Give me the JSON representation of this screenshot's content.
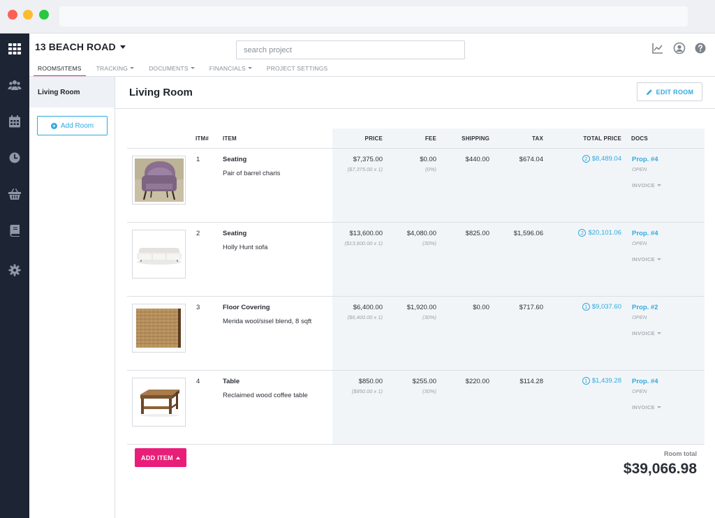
{
  "header": {
    "project_title": "13 BEACH ROAD",
    "search_placeholder": "search project",
    "tabs": [
      {
        "label": "ROOMS/ITEMS",
        "active": true,
        "dropdown": false
      },
      {
        "label": "TRACKING",
        "active": false,
        "dropdown": true
      },
      {
        "label": "DOCUMENTS",
        "active": false,
        "dropdown": true
      },
      {
        "label": "FINANCIALS",
        "active": false,
        "dropdown": true
      },
      {
        "label": "PROJECT SETTINGS",
        "active": false,
        "dropdown": false
      }
    ],
    "icons": [
      "chart-icon",
      "user-icon",
      "help-icon"
    ]
  },
  "rail": {
    "icons": [
      "apps-grid-icon",
      "people-icon",
      "calendar-icon",
      "clock-icon",
      "basket-icon",
      "book-icon",
      "gear-icon"
    ]
  },
  "sidebar": {
    "rooms": [
      {
        "label": "Living Room"
      }
    ],
    "add_room_label": "Add Room"
  },
  "main": {
    "room_title": "Living Room",
    "edit_room_label": "EDIT ROOM",
    "columns": {
      "itm": "ITM#",
      "item": "ITEM",
      "price": "PRICE",
      "fee": "FEE",
      "shipping": "SHIPPING",
      "tax": "TAX",
      "total_price": "TOTAL PRICE",
      "docs": "DOCS"
    },
    "rows": [
      {
        "num": "1",
        "category": "Seating",
        "description": "Pair of barrel charis",
        "image": "barrel-chair-image",
        "price": "$7,375.00",
        "price_detail": "($7,375.00 x 1)",
        "fee": "$0.00",
        "fee_detail": "(0%)",
        "shipping": "$440.00",
        "tax": "$674.04",
        "doc_count": "2",
        "total_price": "$8,489.04",
        "doc": "Prop. #4",
        "doc_status": "OPEN",
        "invoice_label": "INVOICE"
      },
      {
        "num": "2",
        "category": "Seating",
        "description": "Holly Hunt sofa",
        "image": "sofa-image",
        "price": "$13,600.00",
        "price_detail": "($13,600.00 x 1)",
        "fee": "$4,080.00",
        "fee_detail": "(30%)",
        "shipping": "$825.00",
        "tax": "$1,596.06",
        "doc_count": "2",
        "total_price": "$20,101.06",
        "doc": "Prop. #4",
        "doc_status": "OPEN",
        "invoice_label": "INVOICE"
      },
      {
        "num": "3",
        "category": "Floor Covering",
        "description": "Merida wool/sisel blend, 8 sqft",
        "image": "rug-image",
        "price": "$6,400.00",
        "price_detail": "($6,400.00 x 1)",
        "fee": "$1,920.00",
        "fee_detail": "(30%)",
        "shipping": "$0.00",
        "tax": "$717.60",
        "doc_count": "1",
        "total_price": "$9,037.60",
        "doc": "Prop. #2",
        "doc_status": "OPEN",
        "invoice_label": "INVOICE"
      },
      {
        "num": "4",
        "category": "Table",
        "description": "Reclaimed wood coffee table",
        "image": "coffee-table-image",
        "price": "$850.00",
        "price_detail": "($850.00 x 1)",
        "fee": "$255.00",
        "fee_detail": "(30%)",
        "shipping": "$220.00",
        "tax": "$114.28",
        "doc_count": "1",
        "total_price": "$1,439.28",
        "doc": "Prop. #4",
        "doc_status": "OPEN",
        "invoice_label": "INVOICE"
      }
    ],
    "add_item_label": "ADD ITEM",
    "room_total_label": "Room total",
    "room_total_value": "$39,066.98"
  },
  "colors": {
    "accent": "#2ea9e0",
    "brand_pink": "#e91e78",
    "rail_bg": "#1d2433",
    "shade_bg": "#f2f5f8"
  }
}
